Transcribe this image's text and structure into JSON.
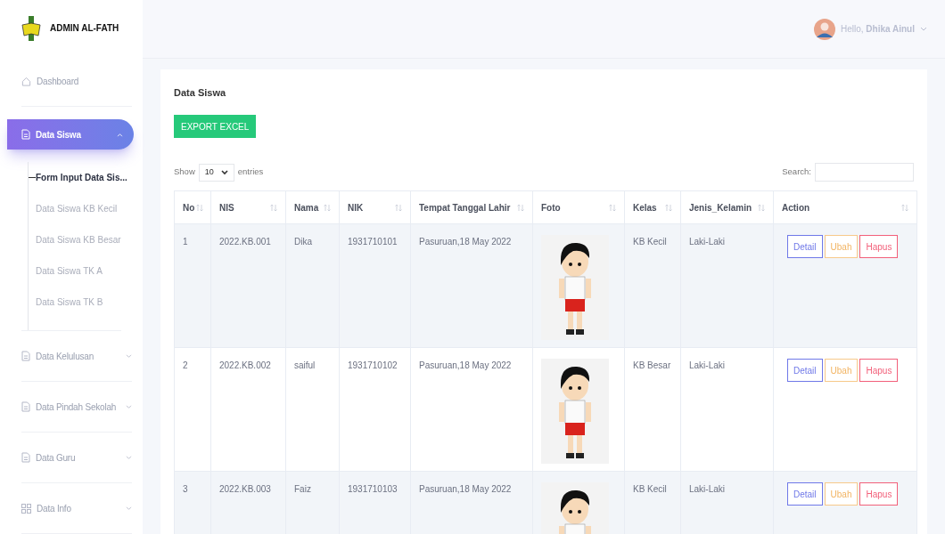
{
  "brand": {
    "title": "ADMIN AL-FATH"
  },
  "header": {
    "greeting": "Hello, **Dhika Ainul**"
  },
  "sidebar": {
    "items": [
      {
        "label": "Dashboard",
        "kind": "link",
        "selected": false
      },
      {
        "label": "Data Siswa",
        "kind": "menu",
        "selected": true,
        "expanded": true,
        "children": [
          {
            "label": "Form Input Data Sis...",
            "selected": true
          },
          {
            "label": "Data Siswa KB Kecil",
            "selected": false
          },
          {
            "label": "Data Siswa KB Besar",
            "selected": false
          },
          {
            "label": "Data Siswa TK A",
            "selected": false
          },
          {
            "label": "Data Siswa TK B",
            "selected": false
          }
        ]
      },
      {
        "label": "Data Kelulusan",
        "kind": "menu",
        "selected": false,
        "expanded": false
      },
      {
        "label": "Data Pindah Sekolah",
        "kind": "menu",
        "selected": false,
        "expanded": false
      },
      {
        "label": "Data Guru",
        "kind": "menu",
        "selected": false,
        "expanded": false
      },
      {
        "label": "Data Info",
        "kind": "menu",
        "selected": false,
        "expanded": false
      }
    ]
  },
  "card": {
    "title": "Data Siswa",
    "export_button": "EXPORT EXCEL",
    "length": {
      "before": "Show",
      "value": "10",
      "after": "entries"
    },
    "search": {
      "label": "Search:"
    },
    "table": {
      "columns": [
        "No",
        "NIS",
        "Nama",
        "NIK",
        "Tempat Tanggal Lahir",
        "Foto",
        "Kelas",
        "Jenis_Kelamin",
        "Action"
      ],
      "rows": [
        {
          "no": "1",
          "nis": "2022.KB.001",
          "nama": "Dika",
          "nik": "1931710101",
          "ttl": "Pasuruan,18 May 2022",
          "kelas": "KB Kecil",
          "jenis_kelamin": "Laki-Laki",
          "actions": [
            "Detail",
            "Ubah",
            "Hapus"
          ]
        },
        {
          "no": "2",
          "nis": "2022.KB.002",
          "nama": "saiful",
          "nik": "1931710102",
          "ttl": "Pasuruan,18 May 2022",
          "kelas": "KB Besar",
          "jenis_kelamin": "Laki-Laki",
          "actions": [
            "Detail",
            "Ubah",
            "Hapus"
          ]
        },
        {
          "no": "3",
          "nis": "2022.KB.003",
          "nama": "Faiz",
          "nik": "1931710103",
          "ttl": "Pasuruan,18 May 2022",
          "kelas": "KB Kecil",
          "jenis_kelamin": "Laki-Laki",
          "actions": [
            "Detail",
            "Ubah",
            "Hapus"
          ]
        }
      ]
    }
  }
}
